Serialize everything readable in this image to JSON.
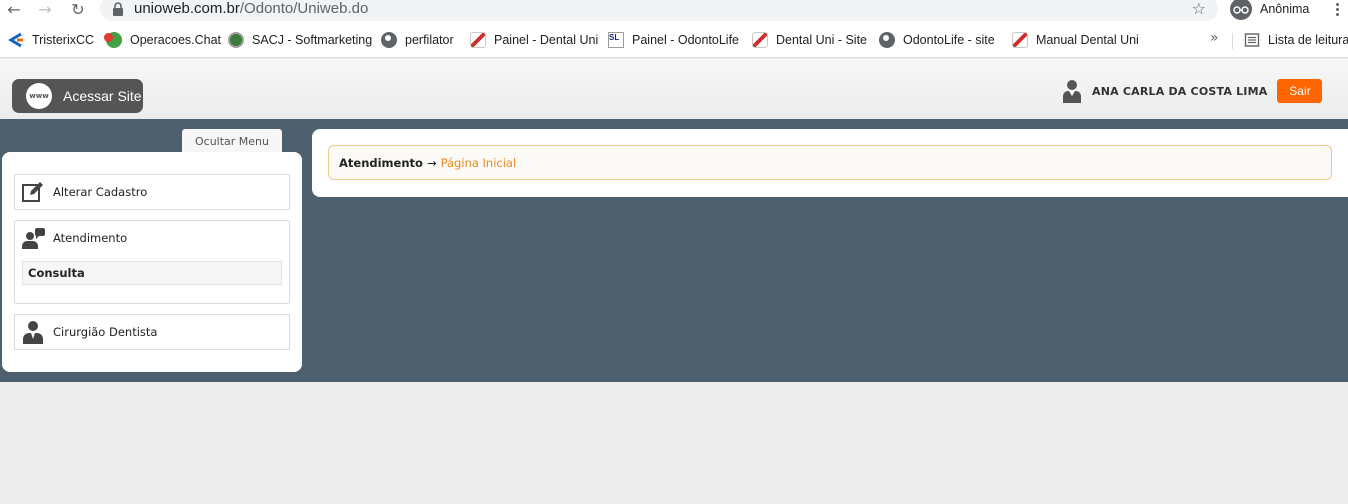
{
  "browser": {
    "url_host": "unioweb.com.br",
    "url_path": "/Odonto/Uniweb.do",
    "profile_label": "Anônima",
    "bookmarks": [
      {
        "label": "TristerixCC",
        "icon": "tristerix-icon"
      },
      {
        "label": "Operacoes.Chat",
        "icon": "chat-icon"
      },
      {
        "label": "SACJ - Softmarketing",
        "icon": "sacj-icon"
      },
      {
        "label": "perfilator",
        "icon": "globe-icon"
      },
      {
        "label": "Painel - Dental Uni",
        "icon": "tooth-icon"
      },
      {
        "label": "Painel - OdontoLife",
        "icon": "sl-icon"
      },
      {
        "label": "Dental Uni - Site",
        "icon": "tooth-icon"
      },
      {
        "label": "OdontoLife - site",
        "icon": "globe-icon"
      },
      {
        "label": "Manual Dental Uni",
        "icon": "tooth-icon"
      }
    ],
    "more_bookmarks": "»",
    "reading_list": "Lista de leitura"
  },
  "header": {
    "site_button": "Acessar Site",
    "www_badge": "www",
    "user_name": "ANA CARLA DA COSTA LIMA",
    "logout": "Sair"
  },
  "menu": {
    "toggle_label": "Ocultar Menu",
    "items": [
      {
        "label": "Alterar Cadastro",
        "icon": "edit-icon"
      },
      {
        "label": "Atendimento",
        "icon": "support-agent-icon",
        "subitems": [
          {
            "label": "Consulta"
          }
        ]
      },
      {
        "label": "Cirurgião Dentista",
        "icon": "dentist-icon"
      }
    ]
  },
  "breadcrumb": {
    "root": "Atendimento",
    "arrow": "→",
    "current": "Página Inicial"
  },
  "colors": {
    "accent": "#ff6600",
    "main_bg": "#4e5f6d",
    "breadcrumb_link": "#e8891d"
  }
}
